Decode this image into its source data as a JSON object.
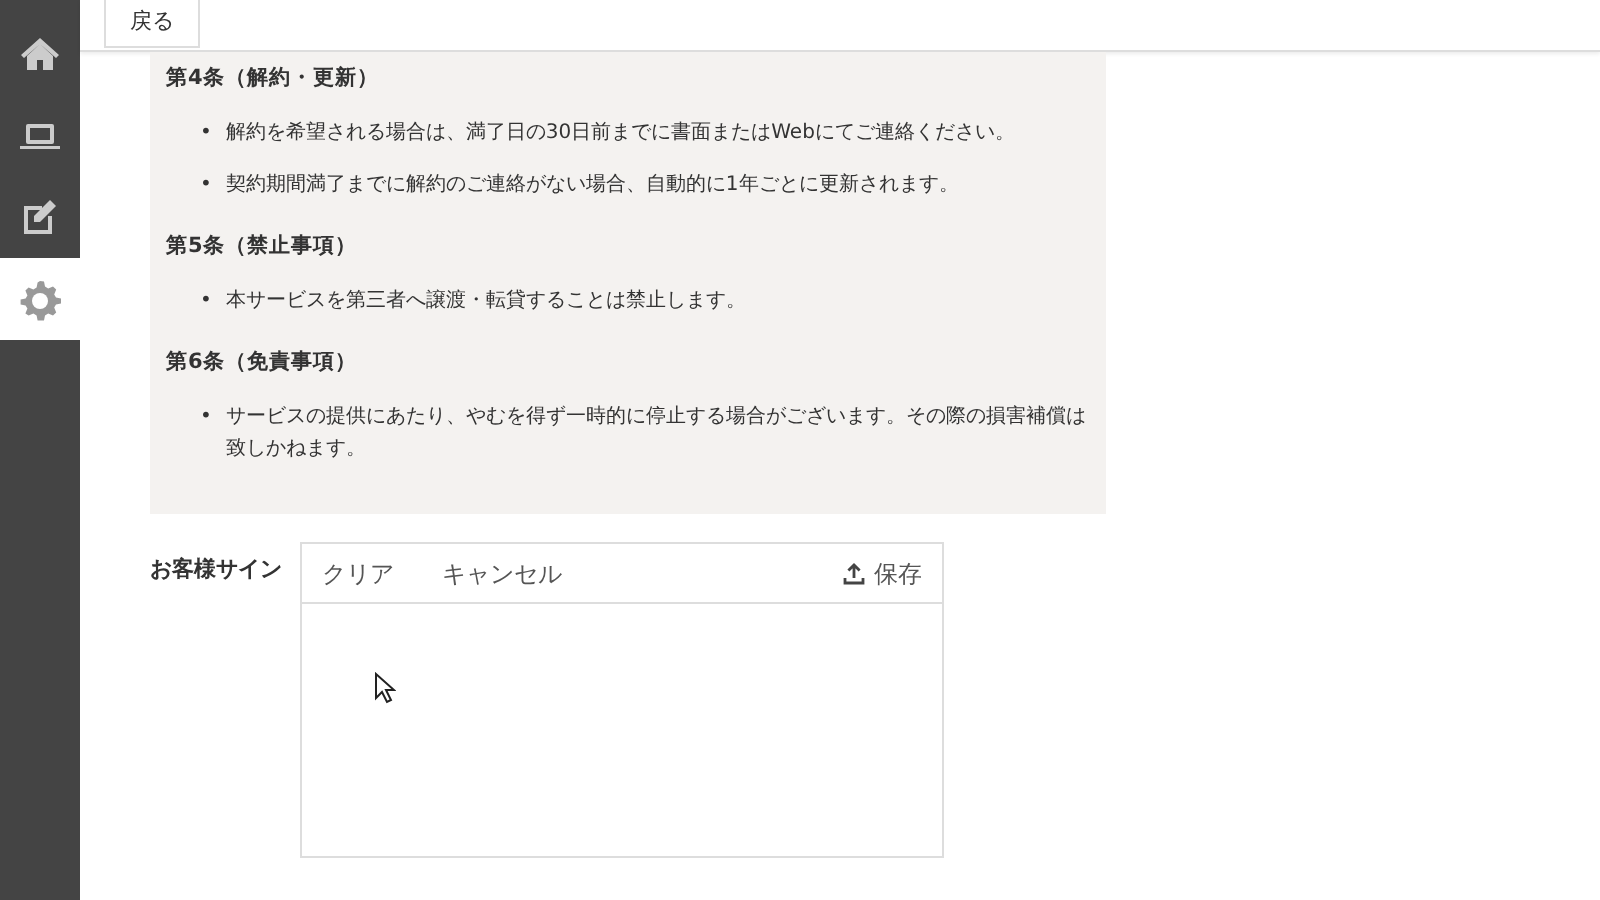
{
  "sidebar": {
    "items": [
      {
        "kind": "home",
        "selected": false
      },
      {
        "kind": "laptop",
        "selected": false
      },
      {
        "kind": "edit",
        "selected": false
      },
      {
        "kind": "settings",
        "selected": true
      }
    ]
  },
  "header": {
    "back_button": "戻る"
  },
  "terms": [
    {
      "heading": "第4条（解約・更新）",
      "items": [
        {
          "bullet": "•",
          "text": "解約を希望される場合は、満了日の30日前までに書面またはWebにてご連絡ください。"
        },
        {
          "bullet": "•",
          "text": "契約期間満了までに解約のご連絡がない場合、自動的に1年ごとに更新されます。"
        }
      ]
    },
    {
      "heading": "第5条（禁止事項）",
      "items": [
        {
          "bullet": "•",
          "text": "本サービスを第三者へ譲渡・転貸することは禁止します。"
        }
      ]
    },
    {
      "heading": "第6条（免責事項）",
      "items": [
        {
          "bullet": "•",
          "text": "サービスの提供にあたり、やむを得ず一時的に停止する場合がございます。その際の損害補償は致しかねます。"
        }
      ]
    }
  ],
  "signature": {
    "label": "お客様サイン",
    "clear_button": "クリア",
    "cancel_button": "キャンセル",
    "save_button": "保存"
  }
}
